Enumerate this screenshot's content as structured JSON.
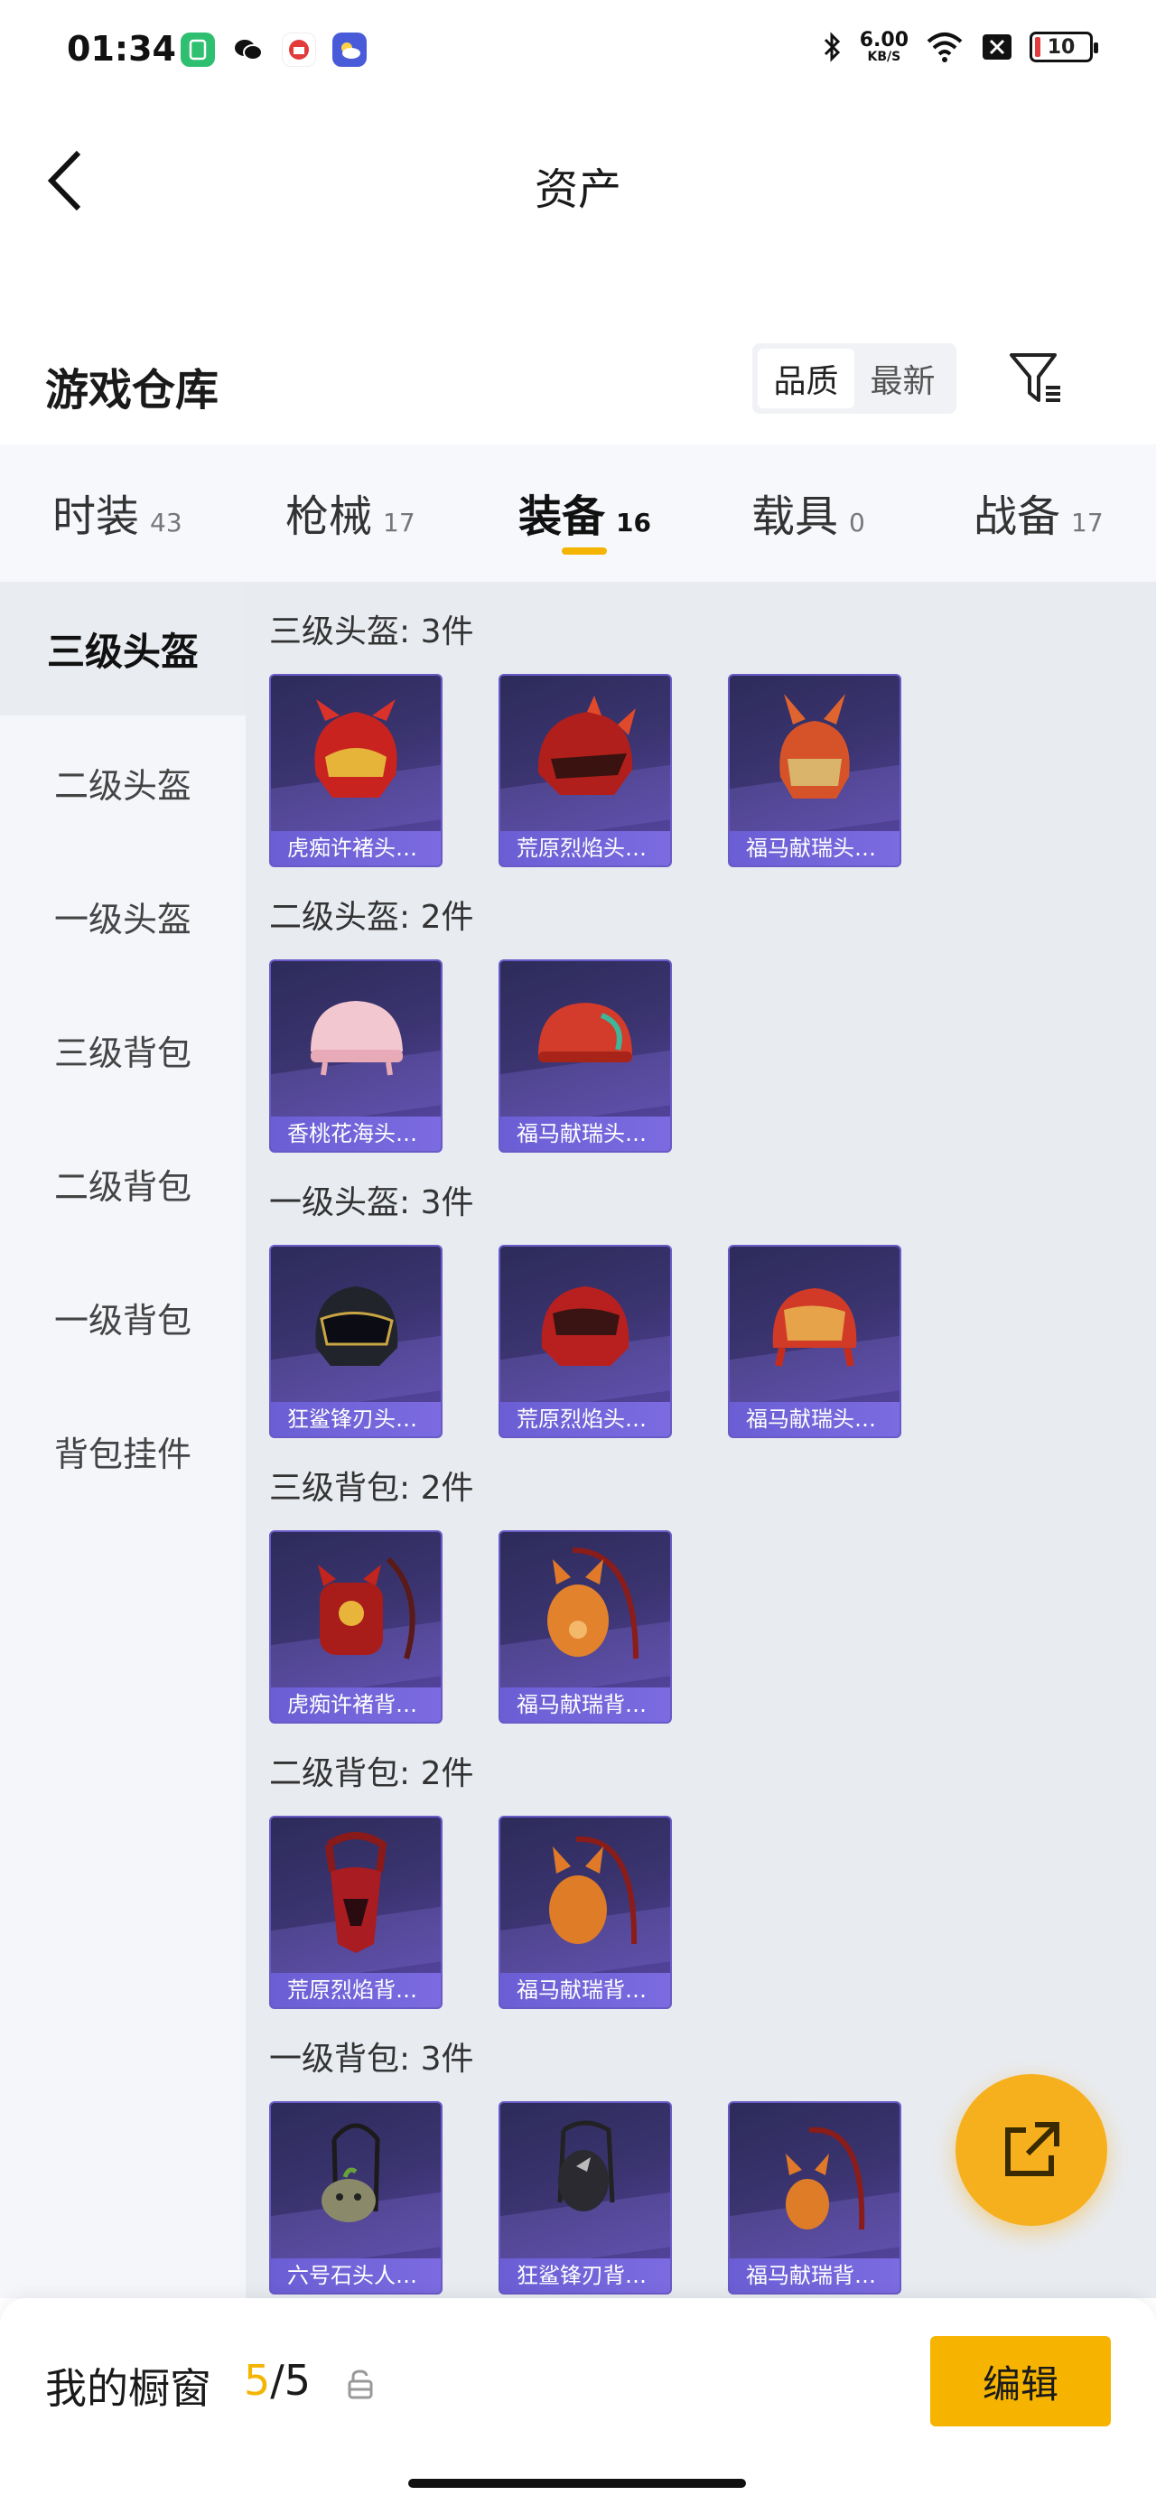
{
  "status_bar": {
    "time": "01:34",
    "net_speed_value": "6.00",
    "net_speed_unit": "KB/S",
    "battery": "10",
    "icons": [
      "phone-manager-icon",
      "wechat-icon",
      "news-app-icon",
      "weather-app-icon",
      "bluetooth-icon",
      "wifi-icon",
      "sim-off-icon"
    ]
  },
  "header": {
    "title": "资产",
    "back_icon": "chevron-left-icon"
  },
  "warehouse": {
    "title": "游戏仓库",
    "sort_options": [
      "品质",
      "最新"
    ],
    "active_sort": "品质",
    "filter_icon": "filter-icon"
  },
  "category_tabs": [
    {
      "label": "时装",
      "count": "43"
    },
    {
      "label": "枪械",
      "count": "17"
    },
    {
      "label": "装备",
      "count": "16"
    },
    {
      "label": "载具",
      "count": "0"
    },
    {
      "label": "战备",
      "count": "17"
    }
  ],
  "active_category": "装备",
  "sidebar": {
    "items": [
      "三级头盔",
      "二级头盔",
      "一级头盔",
      "三级背包",
      "二级背包",
      "一级背包",
      "背包挂件"
    ],
    "active": "三级头盔"
  },
  "sections": [
    {
      "title": "三级头盔: 3件",
      "items": [
        "虎痴许褚头…",
        "荒原烈焰头…",
        "福马献瑞头…"
      ]
    },
    {
      "title": "二级头盔: 2件",
      "items": [
        "香桃花海头…",
        "福马献瑞头…"
      ]
    },
    {
      "title": "一级头盔: 3件",
      "items": [
        "狂鲨锋刃头…",
        "荒原烈焰头…",
        "福马献瑞头…"
      ]
    },
    {
      "title": "三级背包: 2件",
      "items": [
        "虎痴许褚背…",
        "福马献瑞背…"
      ]
    },
    {
      "title": "二级背包: 2件",
      "items": [
        "荒原烈焰背…",
        "福马献瑞背…"
      ]
    },
    {
      "title": "一级背包: 3件",
      "items": [
        "六号石头人…",
        "狂鲨锋刃背…",
        "福马献瑞背…"
      ]
    }
  ],
  "fab": {
    "icon": "share-external-icon"
  },
  "bottom_bar": {
    "label": "我的橱窗",
    "current": "5",
    "separator": "/",
    "total": "5",
    "lock_icon": "lock-icon",
    "edit_label": "编辑"
  },
  "colors": {
    "accent": "#f6b300",
    "card_bg": "#3b3470",
    "card_label_bg": "#6b5ed4"
  }
}
